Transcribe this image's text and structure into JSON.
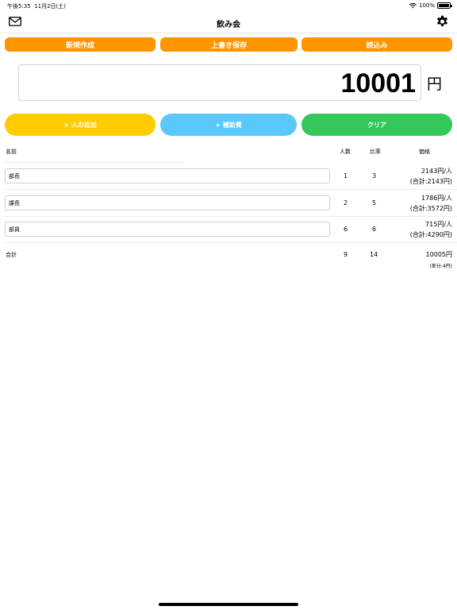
{
  "status": {
    "time": "午後5:35",
    "date": "11月2日(土)",
    "battery": "100%",
    "battery_level": 1.0
  },
  "nav": {
    "title": "飲み会",
    "left_icon": "mail-icon",
    "right_icon": "gear-icon"
  },
  "toolbar": {
    "new_label": "新規作成",
    "save_label": "上書き保存",
    "load_label": "読込み"
  },
  "total_input": {
    "value": "10001",
    "unit": "円"
  },
  "actions": {
    "add_person": "+ 人の追加",
    "subsidy": "+ 補助費",
    "clear": "クリア"
  },
  "table": {
    "headers": {
      "name": "名前",
      "count": "人数",
      "ratio": "比率",
      "price": "価格"
    },
    "rows": [
      {
        "name": "部長",
        "count": "1",
        "ratio": "3",
        "per_person": "2143円/人",
        "subtotal": "(合計:2143円)"
      },
      {
        "name": "課長",
        "count": "2",
        "ratio": "5",
        "per_person": "1786円/人",
        "subtotal": "(合計:3572円)"
      },
      {
        "name": "部員",
        "count": "6",
        "ratio": "6",
        "per_person": "715円/人",
        "subtotal": "(合計:4290円)"
      }
    ],
    "total": {
      "label": "合計",
      "count": "9",
      "ratio": "14",
      "amount": "10005円",
      "diff": "(差分:4円)"
    }
  },
  "colors": {
    "orange": "#ff9500",
    "yellow": "#ffcc00",
    "light_blue": "#5ac8fa",
    "green": "#34c759"
  }
}
